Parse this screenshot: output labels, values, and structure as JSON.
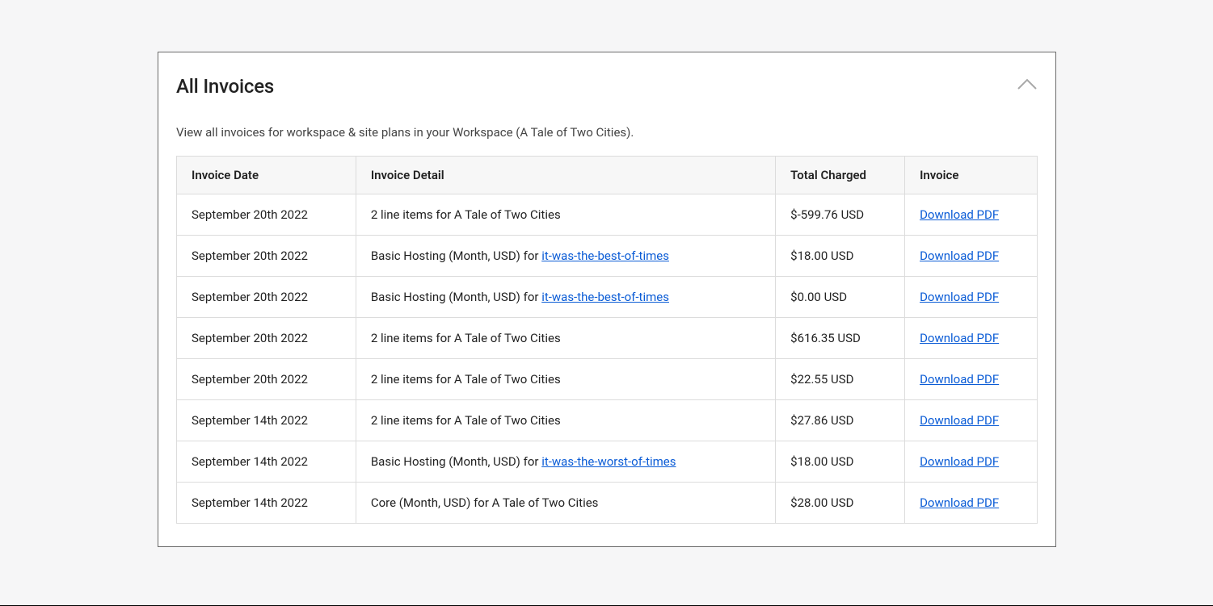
{
  "card": {
    "title": "All Invoices",
    "subtitle": "View all invoices for workspace & site plans in your Workspace (A Tale of Two Cities)."
  },
  "table": {
    "headers": {
      "date": "Invoice Date",
      "detail": "Invoice Detail",
      "total": "Total Charged",
      "invoice": "Invoice"
    },
    "download_label": "Download PDF",
    "rows": [
      {
        "date": "September 20th 2022",
        "detail_prefix": "2 line items for A Tale of Two Cities",
        "detail_link": "",
        "total": "$-599.76 USD"
      },
      {
        "date": "September 20th 2022",
        "detail_prefix": "Basic Hosting (Month, USD) for ",
        "detail_link": "it-was-the-best-of-times",
        "total": "$18.00 USD"
      },
      {
        "date": "September 20th 2022",
        "detail_prefix": "Basic Hosting (Month, USD) for ",
        "detail_link": "it-was-the-best-of-times",
        "total": "$0.00 USD"
      },
      {
        "date": "September 20th 2022",
        "detail_prefix": "2 line items for A Tale of Two Cities",
        "detail_link": "",
        "total": "$616.35 USD"
      },
      {
        "date": "September 20th 2022",
        "detail_prefix": "2 line items for A Tale of Two Cities",
        "detail_link": "",
        "total": "$22.55 USD"
      },
      {
        "date": "September 14th 2022",
        "detail_prefix": "2 line items for A Tale of Two Cities",
        "detail_link": "",
        "total": "$27.86 USD"
      },
      {
        "date": "September 14th 2022",
        "detail_prefix": "Basic Hosting (Month, USD) for ",
        "detail_link": "it-was-the-worst-of-times",
        "total": "$18.00 USD"
      },
      {
        "date": "September 14th 2022",
        "detail_prefix": "Core (Month, USD) for A Tale of Two Cities",
        "detail_link": "",
        "total": "$28.00 USD"
      }
    ]
  }
}
